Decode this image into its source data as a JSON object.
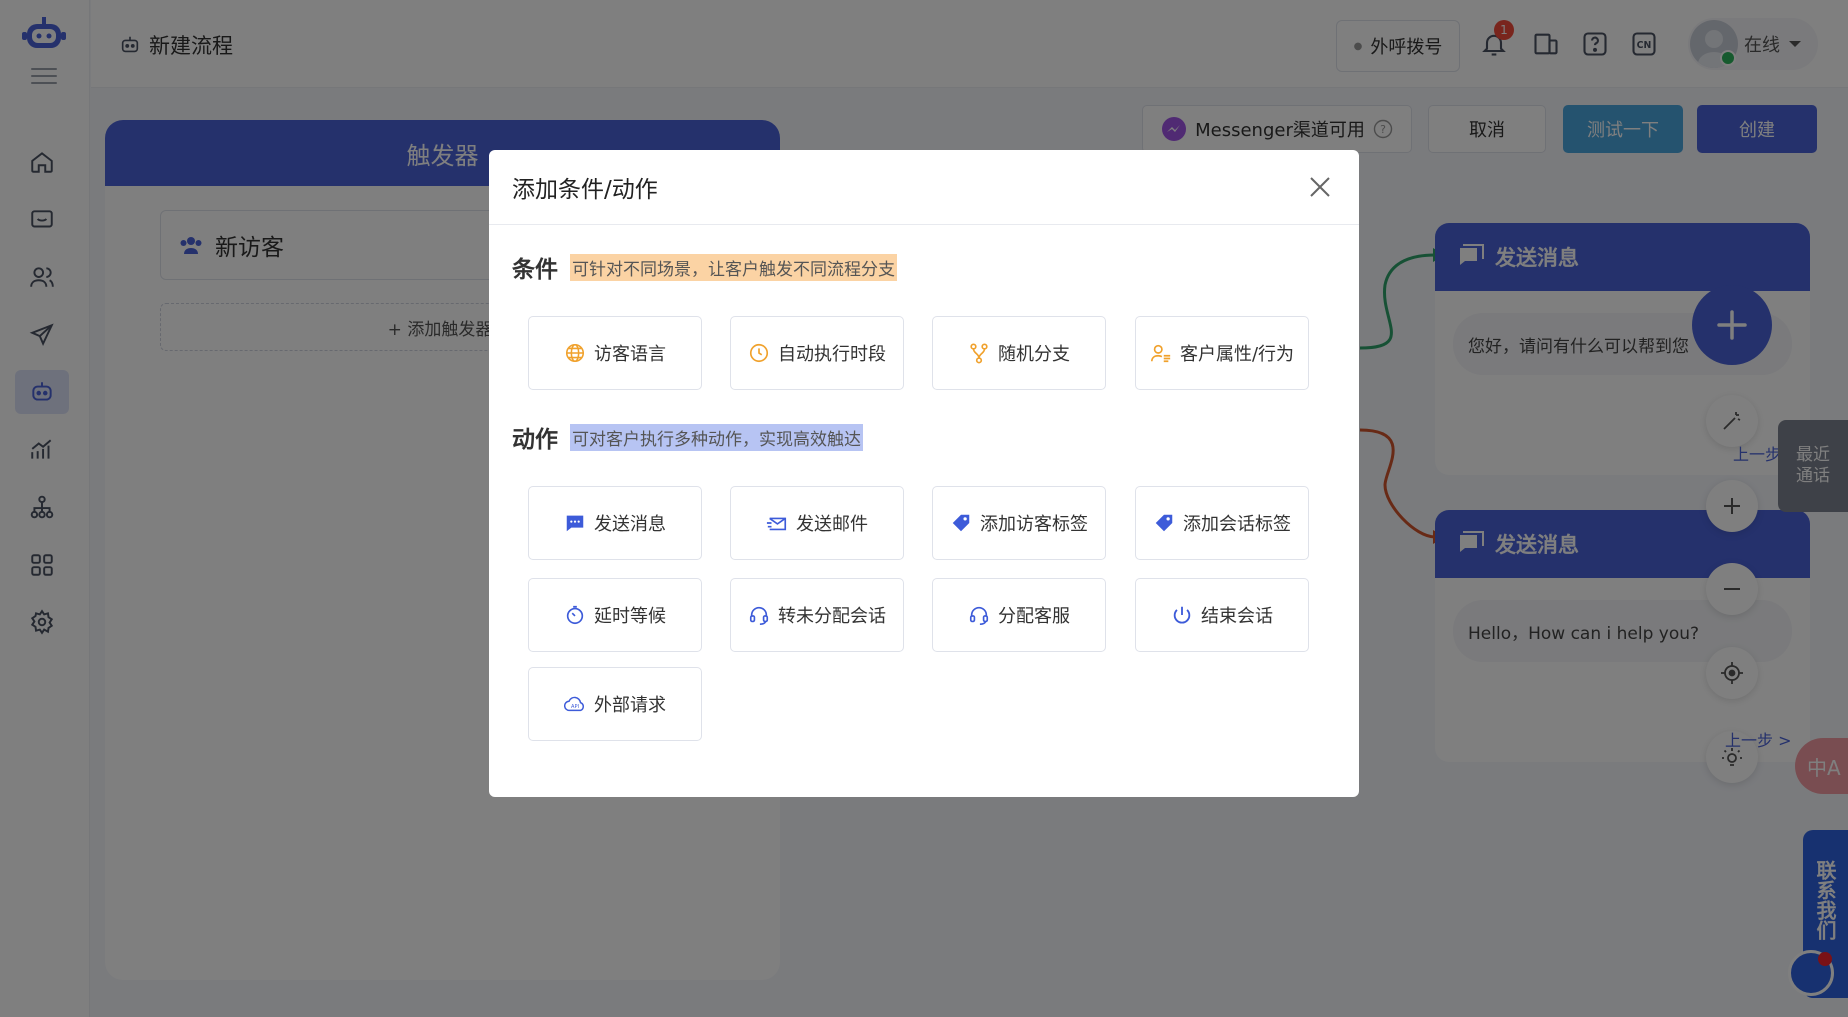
{
  "header": {
    "page_title": "新建流程",
    "outbound_button": "外呼拨号",
    "notification_count": "1",
    "user_status": "在线"
  },
  "actions": {
    "channel_label": "Messenger渠道可用",
    "cancel": "取消",
    "test": "测试一下",
    "create": "创建"
  },
  "trigger": {
    "title": "触发器",
    "selected": "新访客",
    "add_label": "+ 添加触发器"
  },
  "nodes": [
    {
      "title": "发送消息",
      "message": "您好，请问有什么可以帮到您"
    },
    {
      "title": "发送消息",
      "message": "Hello，How can i help you?"
    }
  ],
  "canvas": {
    "prev_step": "上一步 >",
    "recent_calls_line1": "最近",
    "recent_calls_line2": "通话",
    "translate_label": "中A",
    "contact_us": "联系我们"
  },
  "modal": {
    "title": "添加条件/动作",
    "conditions": {
      "title": "条件",
      "hint": "可针对不同场景，让客户触发不同流程分支",
      "items": [
        {
          "label": "访客语言",
          "icon": "globe-icon"
        },
        {
          "label": "自动执行时段",
          "icon": "clock-icon"
        },
        {
          "label": "随机分支",
          "icon": "branch-icon"
        },
        {
          "label": "客户属性/行为",
          "icon": "user-attribute-icon"
        }
      ]
    },
    "actions": {
      "title": "动作",
      "hint": "可对客户执行多种动作，实现高效触达",
      "items": [
        {
          "label": "发送消息",
          "icon": "message-icon"
        },
        {
          "label": "发送邮件",
          "icon": "mail-icon"
        },
        {
          "label": "添加访客标签",
          "icon": "tag-icon"
        },
        {
          "label": "添加会话标签",
          "icon": "tag-icon"
        },
        {
          "label": "延时等候",
          "icon": "timer-icon"
        },
        {
          "label": "转未分配会话",
          "icon": "headset-icon"
        },
        {
          "label": "分配客服",
          "icon": "headset-icon"
        },
        {
          "label": "结束会话",
          "icon": "power-icon"
        },
        {
          "label": "外部请求",
          "icon": "api-cloud-icon"
        }
      ]
    }
  },
  "colors": {
    "primary": "#4a62d8",
    "condition_icon": "#f0a12c",
    "action_icon": "#3d5bd9",
    "test_button": "#4aa6df"
  }
}
